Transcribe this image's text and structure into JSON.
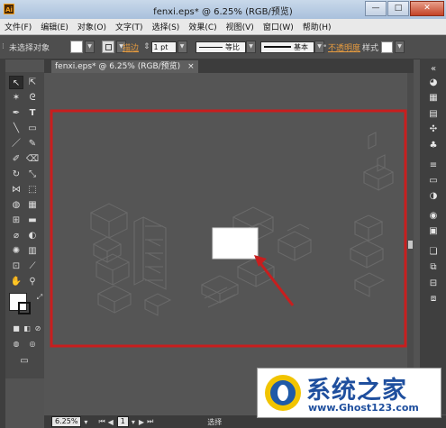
{
  "window": {
    "title": "fenxi.eps* @ 6.25% (RGB/预览)",
    "app_icon": "Ai",
    "minimize": "—",
    "maximize": "□",
    "close": "✕"
  },
  "menu": [
    "文件(F)",
    "编辑(E)",
    "对象(O)",
    "文字(T)",
    "选择(S)",
    "效果(C)",
    "视图(V)",
    "窗口(W)",
    "帮助(H)"
  ],
  "control": {
    "selection_status": "未选择对象",
    "stroke_label": "描边",
    "stroke_weight": "1 pt",
    "uniform_label": "等比",
    "basic_label": "基本",
    "opacity_label": "不透明度",
    "style_label": "样式"
  },
  "document_tab": {
    "label": "fenxi.eps* @ 6.25% (RGB/预览)",
    "close": "×"
  },
  "status": {
    "zoom": "6.25%",
    "page": "1",
    "tool": "选择"
  },
  "watermark": {
    "brand": "系统之家",
    "url": "www.Ghost123.com"
  },
  "colors": {
    "annotation": "#c81e1e",
    "canvas": "#555555",
    "artboard": "#ffffff"
  }
}
